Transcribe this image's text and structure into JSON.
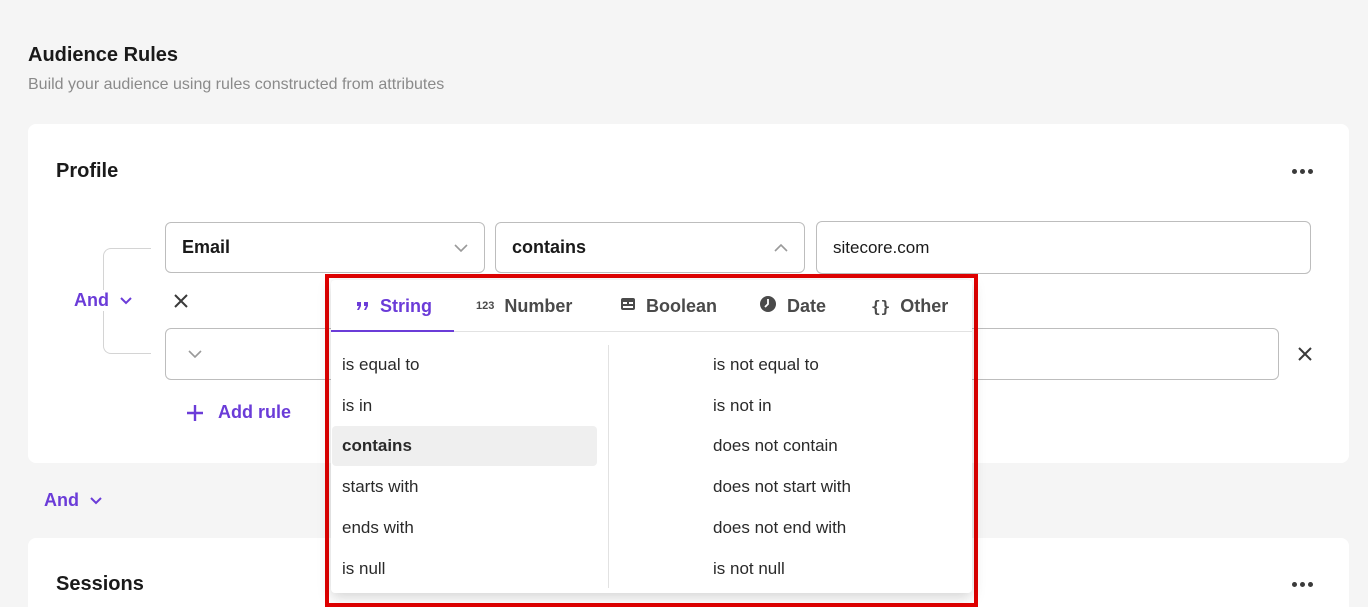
{
  "header": {
    "title": "Audience Rules",
    "subtitle": "Build your audience using rules constructed from attributes"
  },
  "profile": {
    "title": "Profile",
    "and_label": "And",
    "rule1": {
      "attribute": "Email",
      "operator": "contains",
      "value": "sitecore.com"
    },
    "add_rule_label": "Add rule"
  },
  "between_and_label": "And",
  "sessions": {
    "title": "Sessions"
  },
  "dropdown": {
    "tabs": [
      {
        "label": "String",
        "icon": "quote-icon",
        "active": true
      },
      {
        "label": "Number",
        "icon": "number-icon",
        "active": false
      },
      {
        "label": "Boolean",
        "icon": "boolean-icon",
        "active": false
      },
      {
        "label": "Date",
        "icon": "clock-icon",
        "active": false
      },
      {
        "label": "Other",
        "icon": "braces-icon",
        "active": false
      }
    ],
    "number_icon_text": "123",
    "other_icon_text": "{}",
    "left_options": [
      "is equal to",
      "is in",
      "contains",
      "starts with",
      "ends with",
      "is null"
    ],
    "right_options": [
      "is not equal to",
      "is not in",
      "does not contain",
      "does not start with",
      "does not end with",
      "is not null"
    ],
    "selected": "contains"
  },
  "colors": {
    "accent": "#6b3cd8",
    "highlight_border": "#e00000",
    "background": "#f5f5f5"
  }
}
